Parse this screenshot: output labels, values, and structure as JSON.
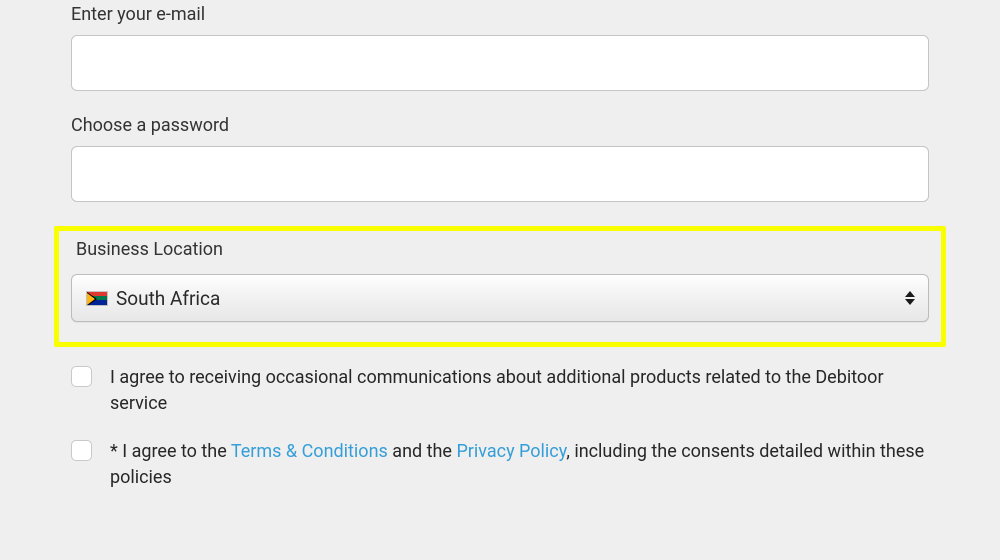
{
  "form": {
    "email": {
      "label": "Enter your e-mail",
      "value": ""
    },
    "password": {
      "label": "Choose a password",
      "value": ""
    },
    "location": {
      "label": "Business Location",
      "selected": "South Africa"
    },
    "consent1": {
      "text": "I agree to receiving occasional communications about additional products related to the Debitoor service"
    },
    "consent2": {
      "prefix": "* I agree to the ",
      "terms": "Terms & Conditions",
      "mid": " and the ",
      "privacy": "Privacy Policy",
      "suffix": ", including the consents detailed within these policies"
    }
  }
}
